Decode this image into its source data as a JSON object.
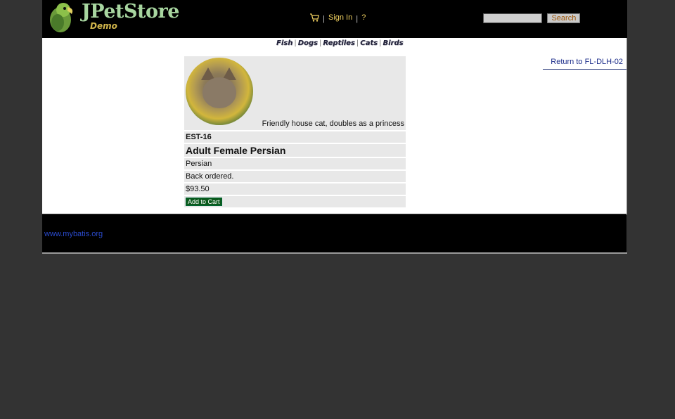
{
  "header": {
    "logo_title": "JPetStore",
    "logo_subtitle": "Demo",
    "cart_icon": "cart-icon",
    "sign_in": "Sign In",
    "separator": "|",
    "help": "?",
    "search_button": "Search",
    "search_value": ""
  },
  "quicklinks": [
    "Fish",
    "Dogs",
    "Reptiles",
    "Cats",
    "Birds"
  ],
  "back_link": "Return to FL-DLH-02",
  "item": {
    "description": "Friendly house cat, doubles as a princess",
    "id": "EST-16",
    "name": "Adult Female Persian",
    "product": "Persian",
    "stock": "Back ordered.",
    "price": "$93.50",
    "add_to_cart": "Add to Cart"
  },
  "footer": {
    "link": "www.mybatis.org"
  },
  "colors": {
    "background": "#333333",
    "header": "#000000",
    "link_gold": "#f0d060",
    "link_blue": "#1b2c8a",
    "add_to_cart": "#0b5a1c"
  }
}
